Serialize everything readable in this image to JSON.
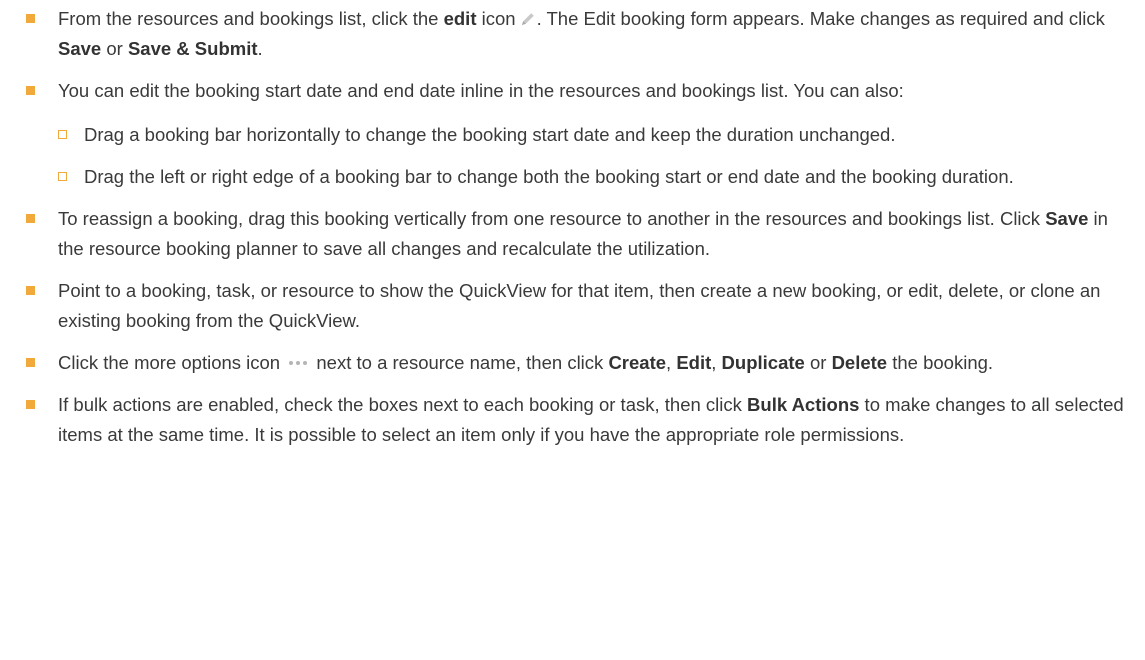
{
  "items": [
    {
      "t1": "From the resources and bookings list, click the ",
      "b1": "edit",
      "t2": " icon",
      "icon": "pencil-icon",
      "t3": ". The Edit booking form appears. Make changes as required and click ",
      "b2": "Save",
      "t4": " or ",
      "b3": "Save & Submit",
      "t5": "."
    },
    {
      "text": "You can edit the booking start date and end date inline in the resources and bookings list. You can also:",
      "sub": [
        "Drag a booking bar horizontally to change the booking start date and keep the duration unchanged.",
        "Drag the left or right edge of a booking bar to change both the booking start or end date and the booking duration."
      ]
    },
    {
      "t1": "To reassign a booking, drag this booking vertically from one resource to another in the resources and bookings list. Click ",
      "b1": "Save",
      "t2": " in the resource booking planner to save all changes and recalculate the utilization."
    },
    {
      "text": "Point to a booking, task, or resource to show the QuickView for that item, then create a new booking, or edit, delete, or clone an existing booking from the QuickView."
    },
    {
      "t1": "Click the more options icon ",
      "icon": "more-options-icon",
      "t2": " next to a resource name, then click ",
      "b1": "Create",
      "t3": ", ",
      "b2": "Edit",
      "t4": ", ",
      "b3": "Duplicate",
      "t5": " or ",
      "b4": "Delete",
      "t6": " the booking."
    },
    {
      "t1": "If bulk actions are enabled, check the boxes next to each booking or task, then click ",
      "b1": "Bulk Actions",
      "t2": " to make changes to all selected items at the same time. It is possible to select an item only if you have the appropriate role permissions."
    }
  ],
  "colors": {
    "bullet": "#f2a93b",
    "text": "#3a3a3a"
  }
}
